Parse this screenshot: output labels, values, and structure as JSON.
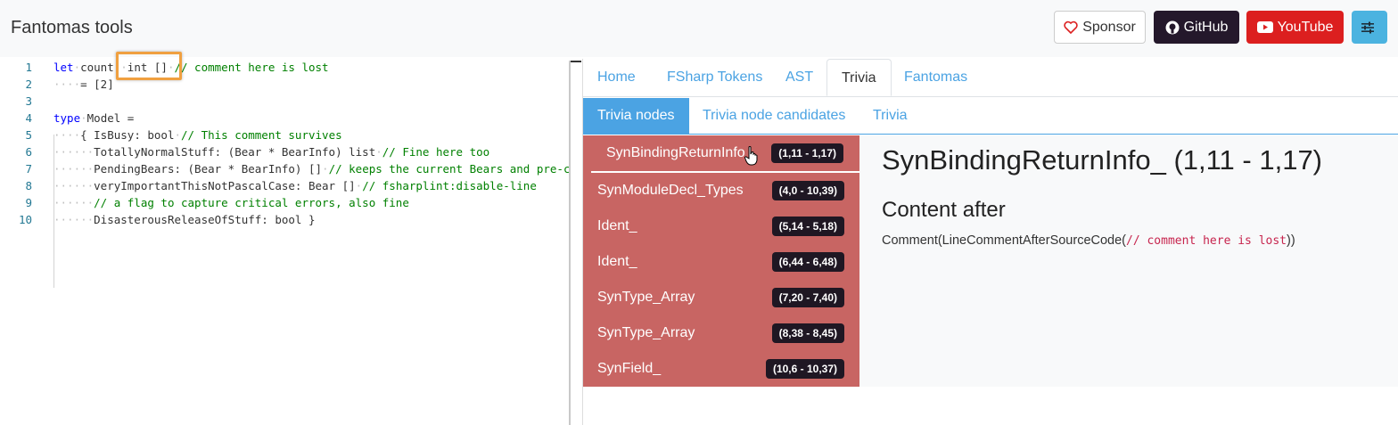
{
  "header": {
    "title": "Fantomas tools",
    "buttons": {
      "sponsor": "Sponsor",
      "github": "GitHub",
      "youtube": "YouTube"
    }
  },
  "editor": {
    "lines": [
      {
        "n": "1"
      },
      {
        "n": "2"
      },
      {
        "n": "3"
      },
      {
        "n": "4"
      },
      {
        "n": "5"
      },
      {
        "n": "6"
      },
      {
        "n": "7"
      },
      {
        "n": "8"
      },
      {
        "n": "9"
      },
      {
        "n": "10"
      }
    ],
    "code": {
      "l1_kw": "let",
      "l1_a": "count:",
      "l1_b": "int []",
      "l1_c": "// comment here is lost",
      "l2": "= [2]",
      "l4_kw": "type",
      "l4": "Model =",
      "l5_a": "{ IsBusy: bool",
      "l5_c": "// This comment survives",
      "l6_a": "TotallyNormalStuff: (Bear * BearInfo) list",
      "l6_c": "// Fine here too",
      "l7_a": "PendingBears: (Bear * BearInfo) []",
      "l7_c": "// keeps the current Bears and pre-c",
      "l8_a": "veryImportantThisNotPascalCase: Bear []",
      "l8_c": "// fsharplint:disable-line",
      "l9_c": "// a flag to capture critical errors, also fine",
      "l10_a": "DisasterousReleaseOfStuff: bool }"
    }
  },
  "tabs": [
    "Home",
    "FSharp Tokens",
    "AST",
    "Trivia",
    "Fantomas"
  ],
  "active_tab": "Trivia",
  "subtabs": [
    "Trivia nodes",
    "Trivia node candidates",
    "Trivia"
  ],
  "active_subtab": "Trivia nodes",
  "nodes": [
    {
      "name": "SynBindingReturnInfo_",
      "range": "(1,11 - 1,17)"
    },
    {
      "name": "SynModuleDecl_Types",
      "range": "(4,0 - 10,39)"
    },
    {
      "name": "Ident_",
      "range": "(5,14 - 5,18)"
    },
    {
      "name": "Ident_",
      "range": "(6,44 - 6,48)"
    },
    {
      "name": "SynType_Array",
      "range": "(7,20 - 7,40)"
    },
    {
      "name": "SynType_Array",
      "range": "(8,38 - 8,45)"
    },
    {
      "name": "SynField_",
      "range": "(10,6 - 10,37)"
    }
  ],
  "details": {
    "title": "SynBindingReturnInfo_ (1,11 - 1,17)",
    "subtitle": "Content after",
    "content_prefix": "Comment(LineCommentAfterSourceCode(",
    "content_code": "// comment here is lost",
    "content_suffix": "))"
  },
  "colors": {
    "accent": "#4ba3e3",
    "node_bg": "#c86563",
    "badge": "#1f1723",
    "youtube": "#dc1f1f",
    "github": "#24182b"
  }
}
